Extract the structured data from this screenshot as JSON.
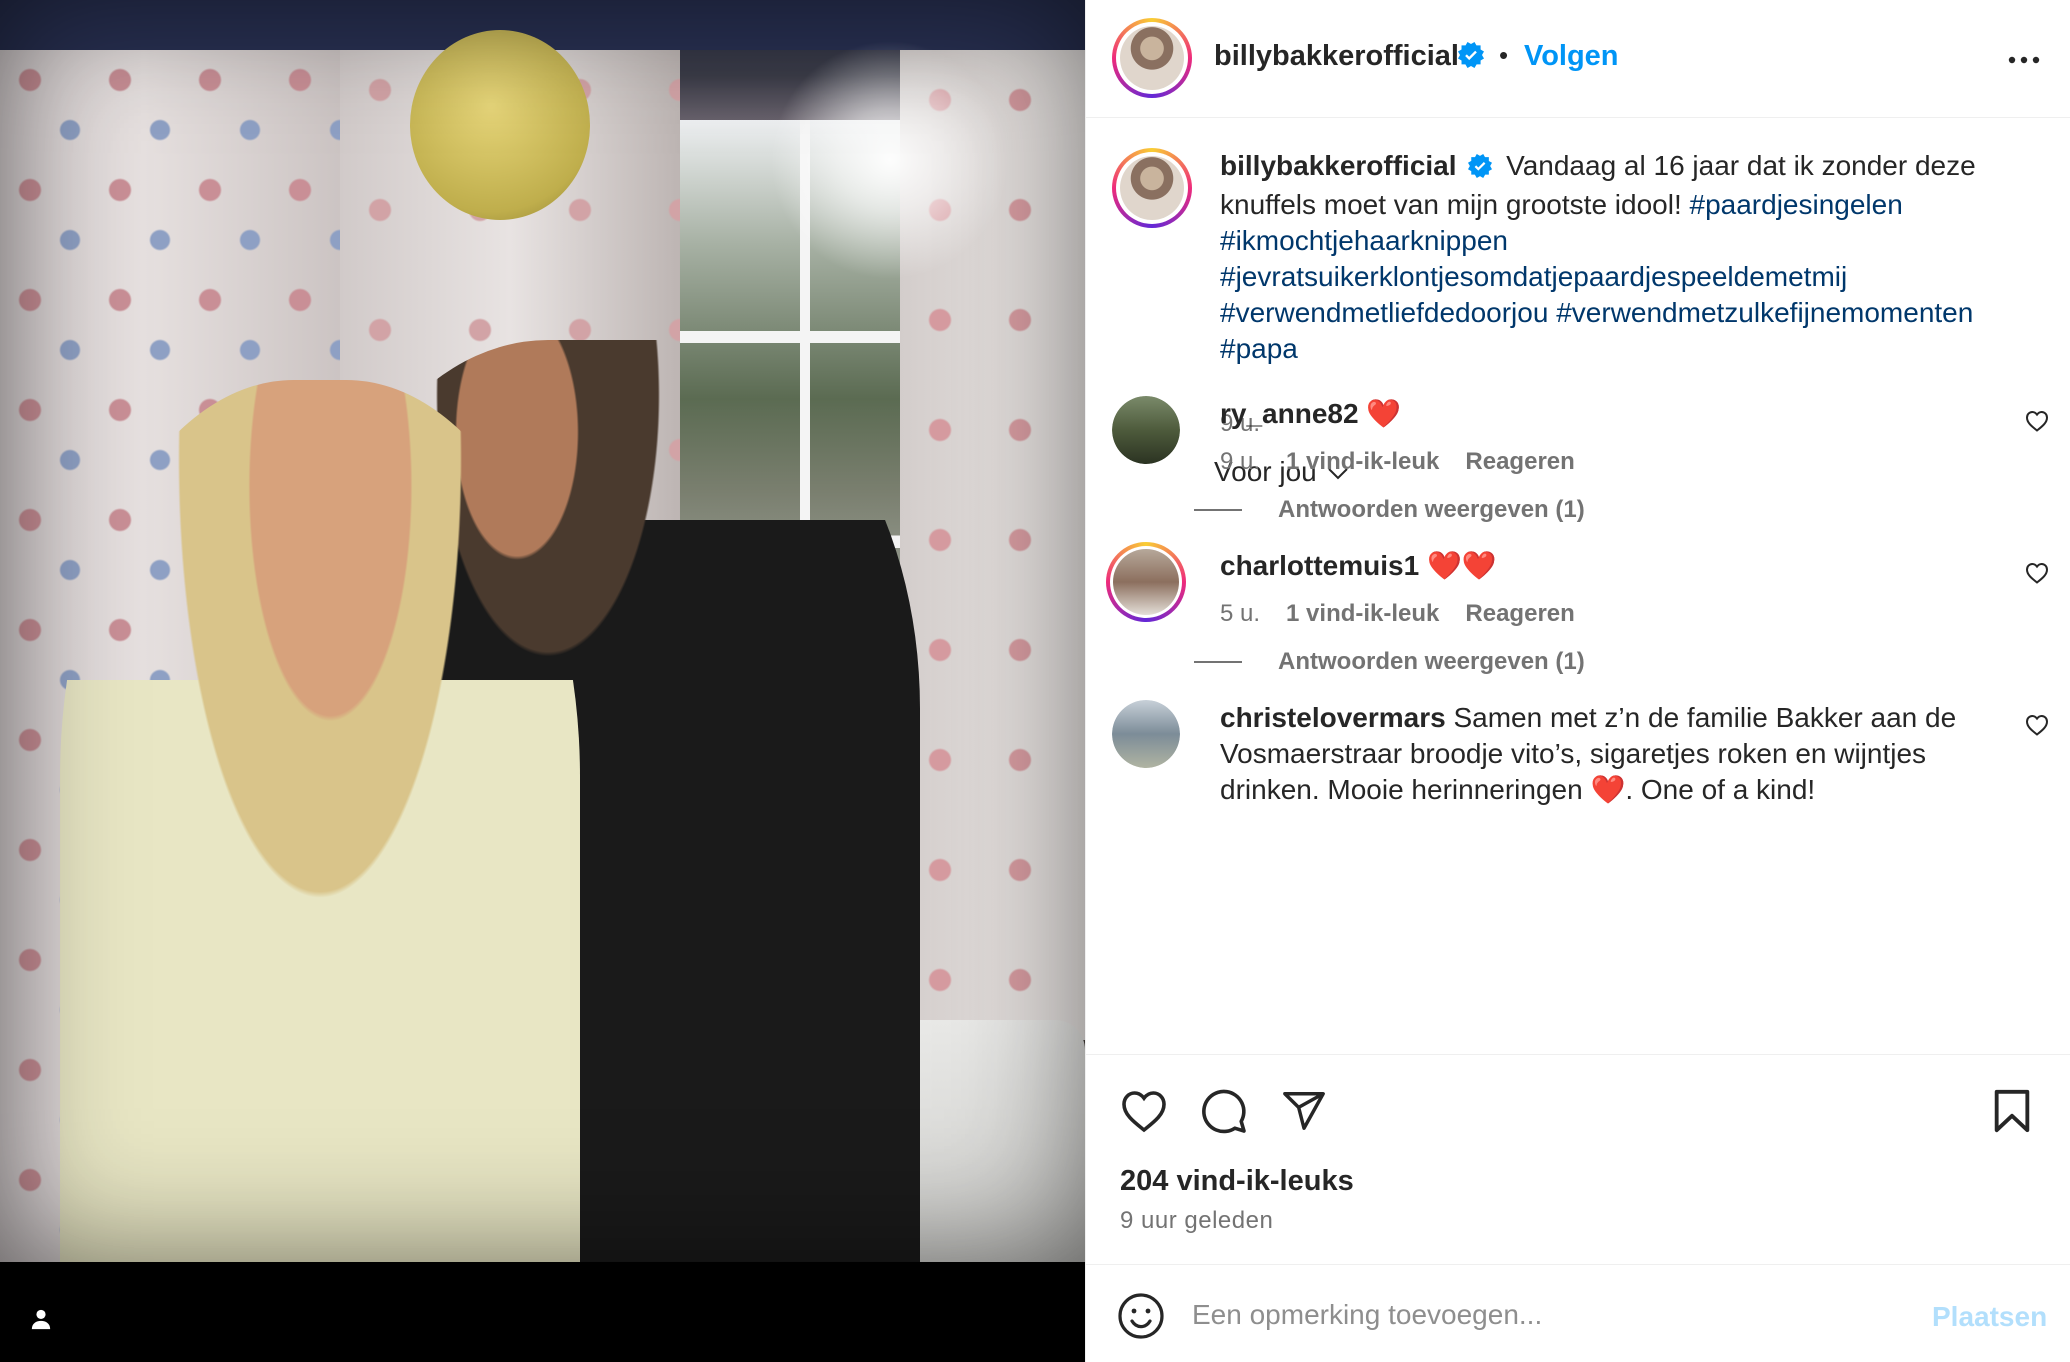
{
  "post": {
    "author": "billybakkerofficial",
    "follow_label": "Volgen",
    "separator": "•",
    "caption_plain": "Vandaag al 16 jaar dat ik zonder deze knuffels moet van mijn grootste idool!",
    "hashtags": [
      "#paardjesingelen",
      "#ikmochtjehaarknippen",
      "#jevratsuikerklontjesomdatjepaardjespeeldemetmij",
      "#verwendmetliefdedoorjou",
      "#verwendmetzulkefijnemomenten",
      "#papa"
    ],
    "caption_time": "9 u.",
    "filter_label": "Voor jou",
    "likes": "204 vind-ik-leuks",
    "posted_ago": "9 uur geleden"
  },
  "comments": [
    {
      "user": "ry_anne82",
      "text": "❤️",
      "time": "9 u.",
      "likes": "1 vind-ik-leuk",
      "reply_label": "Reageren",
      "view_replies": "Antwoorden weergeven (1)"
    },
    {
      "user": "charlottemuis1",
      "text": "❤️❤️",
      "time": "5 u.",
      "likes": "1 vind-ik-leuk",
      "reply_label": "Reageren",
      "view_replies": "Antwoorden weergeven (1)"
    },
    {
      "user": "christelovermars",
      "text": "Samen met z’n de familie Bakker aan de Vosmaerstraar broodje vito’s, sigaretjes roken en wijntjes drinken. Mooie herinneringen ❤️. One of a kind!"
    }
  ],
  "composer": {
    "placeholder": "Een opmerking toevoegen...",
    "post_label": "Plaatsen"
  },
  "colors": {
    "link_blue": "#0095f6",
    "hashtag": "#00376b",
    "muted": "#737373",
    "verified": "#0095f6"
  },
  "icons": [
    "user-tag-icon",
    "verified-badge-icon",
    "more-options-icon",
    "chevron-down-icon",
    "heart-icon",
    "comment-icon",
    "share-icon",
    "bookmark-icon",
    "emoji-icon"
  ]
}
